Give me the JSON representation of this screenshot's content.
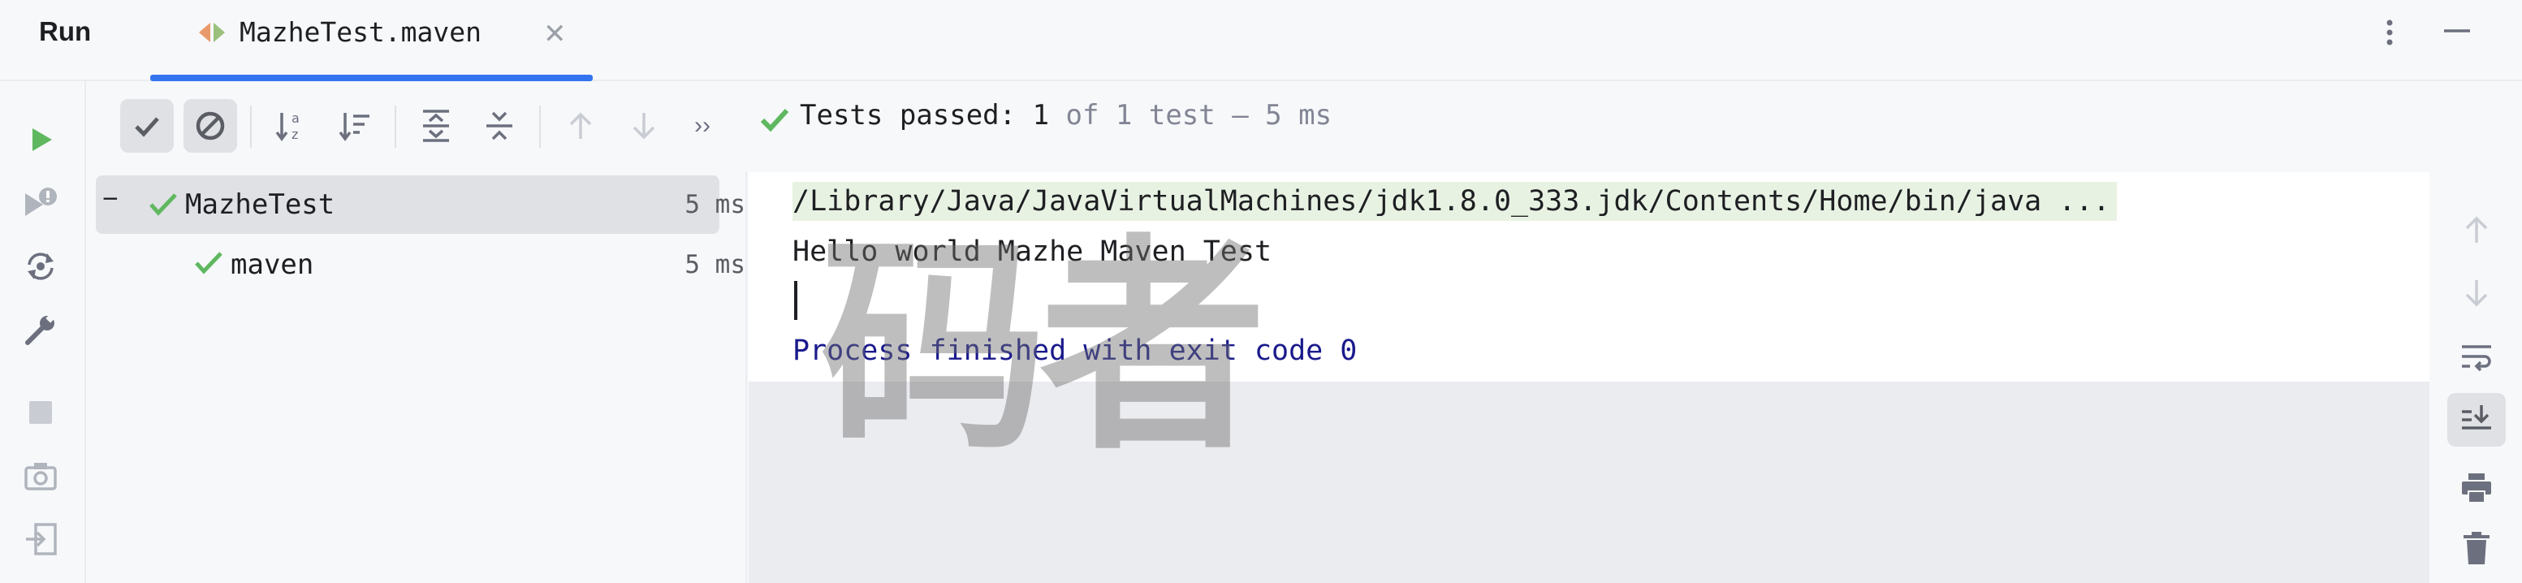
{
  "title_bar": {
    "run_label": "Run",
    "tab_label": "MazheTest.maven",
    "tab_close_glyph": "✕",
    "accent_color": "#3574f0"
  },
  "left_toolbar": {
    "icons": [
      "rerun-icon",
      "rerun-failed-icon",
      "toggle-auto-test-icon",
      "settings-wrench-icon",
      "stop-icon",
      "screenshot-camera-icon",
      "exit-icon"
    ]
  },
  "tree_toolbar": {
    "icons": [
      "show-passed-icon",
      "show-ignored-icon",
      "sort-alphabetically-icon",
      "sort-by-duration-icon",
      "expand-all-icon",
      "collapse-all-icon",
      "previous-failed-icon",
      "next-failed-icon",
      "more-icon"
    ],
    "more_glyph": "››"
  },
  "status": {
    "main": "Tests passed: 1",
    "sub": " of 1 test – 5 ms",
    "pass_color": "#5fb85f"
  },
  "tree": {
    "collapse_glyph": "−",
    "rows": [
      {
        "label": "MazheTest",
        "time": "5 ms"
      },
      {
        "label": "maven",
        "time": "5 ms"
      }
    ]
  },
  "console": {
    "command": "/Library/Java/JavaVirtualMachines/jdk1.8.0_333.jdk/Contents/Home/bin/java ...",
    "output": "Hello world Mazhe Maven Test",
    "exit": "Process finished with exit code 0"
  },
  "watermark": {
    "text": "码者"
  },
  "right_toolbar": {
    "icons": [
      "scroll-up-icon",
      "scroll-down-icon",
      "soft-wrap-icon",
      "scroll-to-end-icon",
      "print-icon",
      "clear-all-icon"
    ]
  }
}
